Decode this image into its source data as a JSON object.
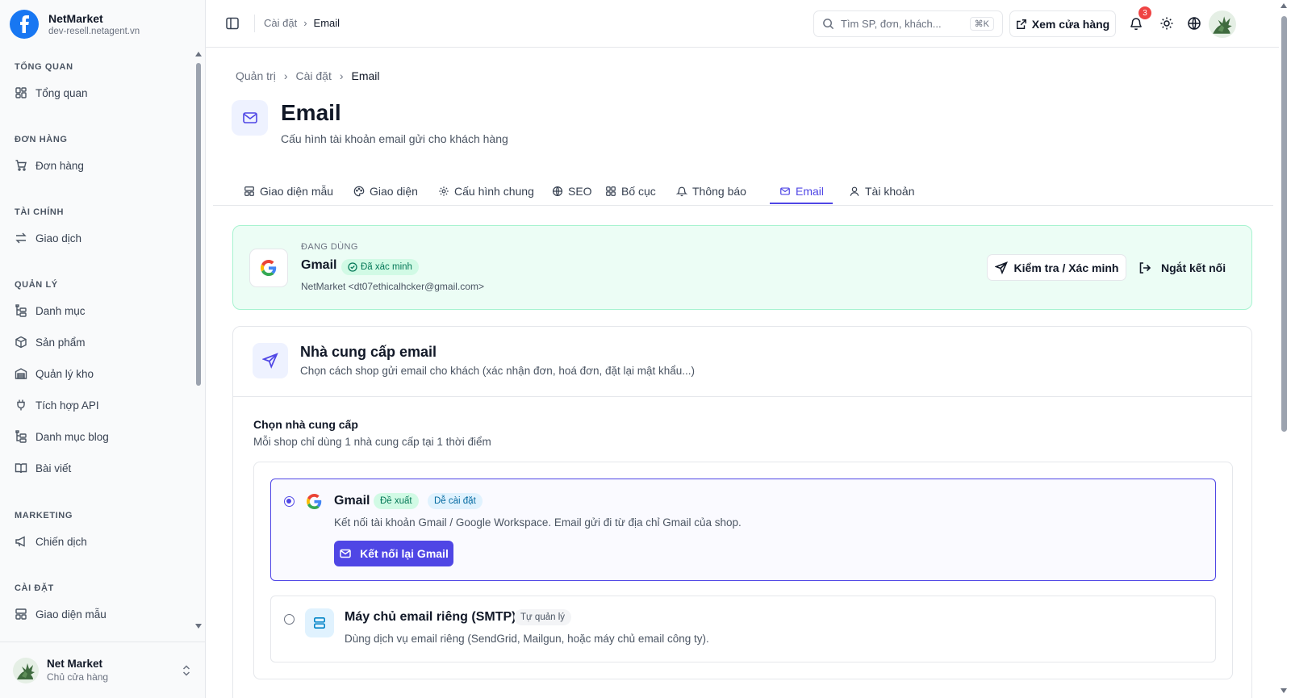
{
  "brand": {
    "name": "NetMarket",
    "domain": "dev-resell.netagent.vn"
  },
  "sidebar": {
    "sections": [
      {
        "title": "TỔNG QUAN",
        "items": [
          {
            "label": "Tổng quan",
            "icon": "dashboard-icon"
          }
        ]
      },
      {
        "title": "ĐƠN HÀNG",
        "items": [
          {
            "label": "Đơn hàng",
            "icon": "cart-icon"
          }
        ]
      },
      {
        "title": "TÀI CHÍNH",
        "items": [
          {
            "label": "Giao dịch",
            "icon": "transfer-icon"
          }
        ]
      },
      {
        "title": "QUẢN LÝ",
        "items": [
          {
            "label": "Danh mục",
            "icon": "category-tree-icon"
          },
          {
            "label": "Sản phẩm",
            "icon": "package-icon"
          },
          {
            "label": "Quản lý kho",
            "icon": "warehouse-icon"
          },
          {
            "label": "Tích hợp API",
            "icon": "plug-icon"
          },
          {
            "label": "Danh mục blog",
            "icon": "category-tree-icon"
          },
          {
            "label": "Bài viết",
            "icon": "book-icon"
          }
        ]
      },
      {
        "title": "MARKETING",
        "items": [
          {
            "label": "Chiến dịch",
            "icon": "megaphone-icon"
          }
        ]
      },
      {
        "title": "CÀI ĐẶT",
        "items": [
          {
            "label": "Giao diện mẫu",
            "icon": "layout-icon"
          }
        ]
      }
    ],
    "user": {
      "name": "Net Market",
      "role": "Chủ cửa hàng"
    }
  },
  "topbar": {
    "breadcrumb": [
      "Cài đặt",
      "Email"
    ],
    "search_placeholder": "Tìm SP, đơn, khách...",
    "search_shortcut": "⌘K",
    "view_store": "Xem cửa hàng",
    "notification_count": "3"
  },
  "page": {
    "breadcrumb": [
      "Quản trị",
      "Cài đặt",
      "Email"
    ],
    "title": "Email",
    "subtitle": "Cấu hình tài khoản email gửi cho khách hàng"
  },
  "tabs": [
    {
      "label": "Giao diện mẫu",
      "icon": "layout-icon"
    },
    {
      "label": "Giao diện",
      "icon": "palette-icon"
    },
    {
      "label": "Cấu hình chung",
      "icon": "gear-icon"
    },
    {
      "label": "SEO",
      "icon": "globe-icon"
    },
    {
      "label": "Bố cục",
      "icon": "grid-icon"
    },
    {
      "label": "Thông báo",
      "icon": "bell-icon"
    },
    {
      "label": "Email",
      "icon": "mail-icon",
      "active": true
    },
    {
      "label": "Tài khoản",
      "icon": "user-icon"
    }
  ],
  "current": {
    "label": "ĐANG DÙNG",
    "provider": "Gmail",
    "status": "Đã xác minh",
    "sender": "NetMarket <dt07ethicalhcker@gmail.com>",
    "verify_button": "Kiểm tra / Xác minh",
    "disconnect_button": "Ngắt kết nối"
  },
  "provider_section": {
    "title": "Nhà cung cấp email",
    "subtitle": "Chọn cách shop gửi email cho khách (xác nhận đơn, hoá đơn, đặt lại mật khẩu...)",
    "choose_title": "Chọn nhà cung cấp",
    "choose_subtitle": "Mỗi shop chỉ dùng 1 nhà cung cấp tại 1 thời điểm",
    "options": [
      {
        "name": "Gmail",
        "badges": [
          "Đề xuất",
          "Dễ cài đặt"
        ],
        "description": "Kết nối tài khoản Gmail / Google Workspace. Email gửi đi từ địa chỉ Gmail của shop.",
        "button": "Kết nối lại Gmail",
        "selected": true
      },
      {
        "name": "Máy chủ email riêng (SMTP)",
        "badges": [
          "Tự quản lý"
        ],
        "description": "Dùng dịch vụ email riêng (SendGrid, Mailgun, hoặc máy chủ email công ty).",
        "selected": false
      }
    ]
  },
  "colors": {
    "accent": "#4f46e5",
    "success_bg": "#ecfdf5",
    "success_text": "#047857",
    "brand_blue": "#1877f2"
  }
}
